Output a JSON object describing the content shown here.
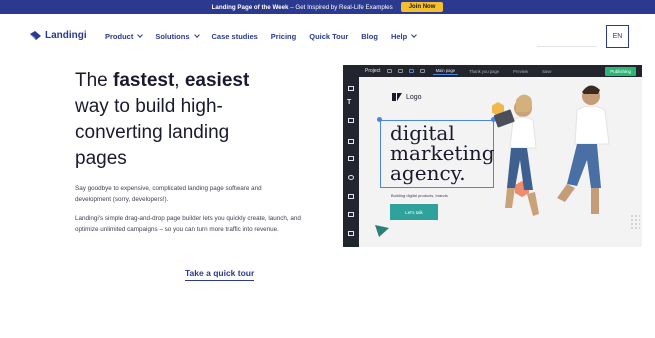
{
  "announcement": {
    "lead": "Landing Page of the Week",
    "rest": " – Get Inspired by Real-Life Examples",
    "cta": "Join Now"
  },
  "brand": {
    "name": "Landingi"
  },
  "nav": {
    "items": [
      {
        "label": "Product",
        "dropdown": true
      },
      {
        "label": "Solutions",
        "dropdown": true
      },
      {
        "label": "Case studies",
        "dropdown": false
      },
      {
        "label": "Pricing",
        "dropdown": false
      },
      {
        "label": "Quick Tour",
        "dropdown": false
      },
      {
        "label": "Blog",
        "dropdown": false
      },
      {
        "label": "Help",
        "dropdown": true
      }
    ],
    "language": "EN"
  },
  "hero": {
    "title_pre": "The ",
    "title_b1": "fastest",
    "title_sep": ", ",
    "title_b2": "easiest",
    "title_rest": " way to build high-converting landing pages",
    "para1": "Say goodbye to expensive, complicated landing page software and development (sorry, developers!).",
    "para2": "Landingi's simple drag-and-drop page builder lets you quickly create, launch, and optimize unlimited campaigns – so you can turn more traffic into revenue.",
    "tour_link": "Take a quick tour"
  },
  "editor": {
    "project": "Project",
    "tabs": [
      "Main page",
      "Thank you page"
    ],
    "preview": "Preview",
    "save": "Save",
    "publish": "Publishing",
    "canvas": {
      "logo": "Logo",
      "headline": "digital marketing agency.",
      "subline": "Building digital products, brands",
      "button": "Let's talk"
    }
  },
  "colors": {
    "brand": "#2b3a8f",
    "announcement_bg": "#2b3a8f",
    "cta_yellow": "#f4c12c",
    "teal": "#2fa39b",
    "publish_green": "#2bb673"
  }
}
